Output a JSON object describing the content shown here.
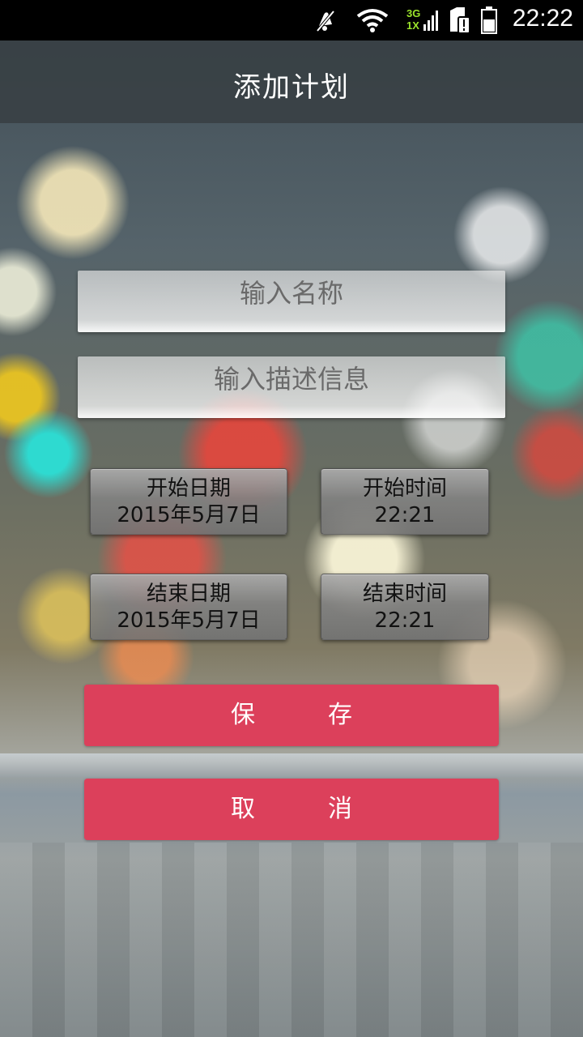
{
  "status_bar": {
    "time": "22:22",
    "network_top": "3G",
    "network_bottom": "1X",
    "icons": [
      "mute-icon",
      "wifi-icon",
      "signal-icon",
      "sim-alert-icon",
      "battery-icon"
    ]
  },
  "header": {
    "title": "添加计划"
  },
  "form": {
    "name_placeholder": "输入名称",
    "desc_placeholder": "输入描述信息"
  },
  "schedule": {
    "start_date": {
      "label": "开始日期",
      "value": "2015年5月7日"
    },
    "start_time": {
      "label": "开始时间",
      "value": "22:21"
    },
    "end_date": {
      "label": "结束日期",
      "value": "2015年5月7日"
    },
    "end_time": {
      "label": "结束时间",
      "value": "22:21"
    }
  },
  "actions": {
    "save_first": "保",
    "save_second": "存",
    "cancel_first": "取",
    "cancel_second": "消"
  },
  "colors": {
    "accent": "#dc405b",
    "status_bar": "#000000"
  }
}
